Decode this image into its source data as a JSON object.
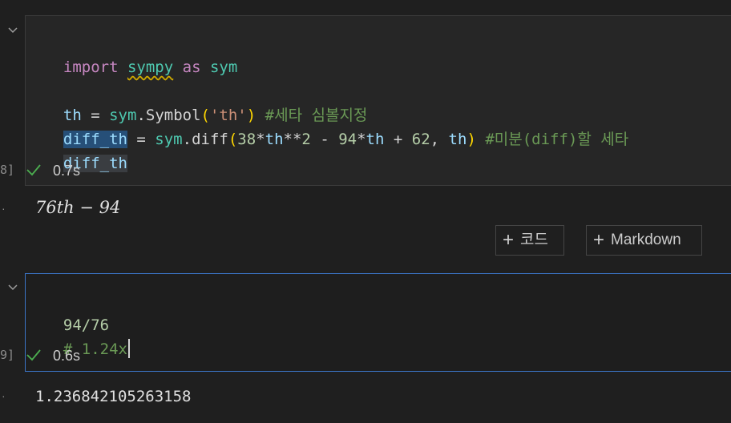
{
  "cell1": {
    "exec_count": "8]",
    "code_lines": [
      [
        "import",
        " ",
        "sympy",
        " ",
        "as",
        " ",
        "sym"
      ],
      [
        "th",
        " = ",
        "sym",
        ".",
        "Symbol",
        "(",
        "'th'",
        ")",
        " ",
        "#세타 심볼지정"
      ],
      [
        "diff_th",
        " = ",
        "sym",
        ".",
        "diff",
        "(",
        "38",
        "*",
        "th",
        "**",
        "2",
        " - ",
        "94",
        "*",
        "th",
        " + ",
        "62",
        ", ",
        "th",
        ")",
        " ",
        "#미분(diff)할 세타"
      ],
      [
        "diff_th"
      ]
    ],
    "status_time": "0.7s",
    "output": "76th − 94"
  },
  "add_cell": {
    "code_label": "코드",
    "markdown_label": "Markdown"
  },
  "cell2": {
    "exec_count": "9]",
    "code_lines": [
      [
        "94/76"
      ],
      [
        "# 1.24x"
      ]
    ],
    "status_time": "0.6s",
    "output": "1.236842105263158"
  },
  "colors": {
    "focus_border": "#3b74c6",
    "success_check": "#4caf50",
    "keyword": "#c586c0",
    "comment": "#6a9955"
  },
  "icons": {
    "collapse": "chevron-down-icon",
    "success": "check-icon",
    "add": "plus-icon"
  }
}
